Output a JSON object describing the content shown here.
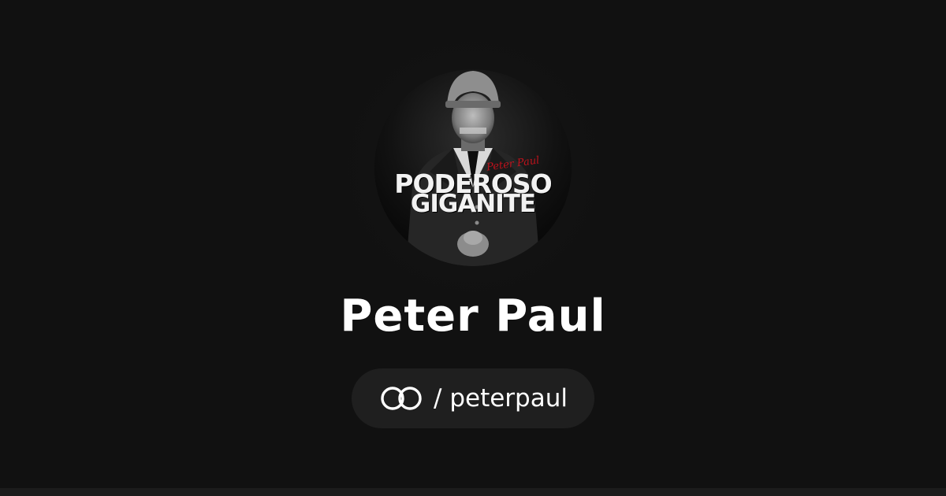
{
  "profile": {
    "name": "Peter Paul",
    "handle_prefix": "/ ",
    "handle": "peterpaul"
  },
  "cover": {
    "signature": "Peter Paul",
    "title_line1": "PODEROSO",
    "title_line2": "GIGANITE"
  },
  "icons": {
    "brand": "linked-rings-logo-icon"
  },
  "colors": {
    "background": "#111111",
    "pill": "#1f1f1f",
    "text": "#ffffff",
    "signature_red": "#c0121c"
  }
}
